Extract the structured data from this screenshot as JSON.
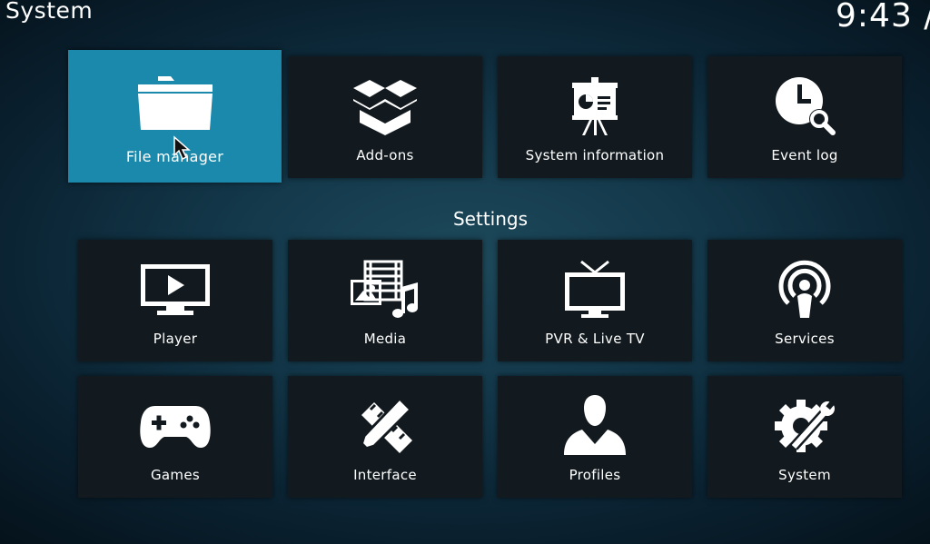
{
  "header": {
    "title": "System",
    "clock": "9:43 /"
  },
  "system_tiles": [
    {
      "label": "File manager",
      "icon": "folder-icon",
      "focused": true
    },
    {
      "label": "Add-ons",
      "icon": "open-box-icon"
    },
    {
      "label": "System information",
      "icon": "presentation-board-icon"
    },
    {
      "label": "Event log",
      "icon": "clock-search-icon"
    }
  ],
  "settings": {
    "heading": "Settings",
    "tiles": [
      {
        "label": "Player",
        "icon": "monitor-play-icon"
      },
      {
        "label": "Media",
        "icon": "media-library-icon"
      },
      {
        "label": "PVR & Live TV",
        "icon": "tv-antenna-icon"
      },
      {
        "label": "Services",
        "icon": "broadcast-person-icon"
      },
      {
        "label": "Games",
        "icon": "gamepad-icon"
      },
      {
        "label": "Interface",
        "icon": "pencil-ruler-icon"
      },
      {
        "label": "Profiles",
        "icon": "user-silhouette-icon"
      },
      {
        "label": "System",
        "icon": "gear-wrench-icon"
      }
    ]
  },
  "colors": {
    "focus": "#1a89ab",
    "tile": "#121a1f",
    "text": "#ffffff"
  }
}
